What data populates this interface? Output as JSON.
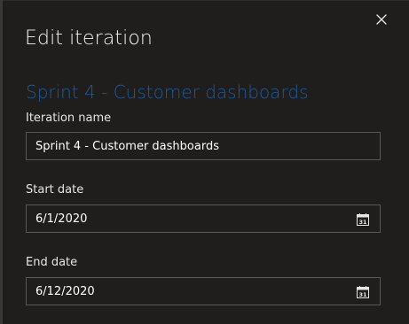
{
  "dialog": {
    "title": "Edit iteration",
    "close_icon": "close-icon"
  },
  "iteration": {
    "heading": "Sprint 4 - Customer dashboards"
  },
  "fields": {
    "name": {
      "label": "Iteration name",
      "value": "Sprint 4 - Customer dashboards"
    },
    "start_date": {
      "label": "Start date",
      "value": "6/1/2020",
      "icon": "calendar-icon",
      "icon_text": "31"
    },
    "end_date": {
      "label": "End date",
      "value": "6/12/2020",
      "icon": "calendar-icon",
      "icon_text": "31"
    }
  },
  "colors": {
    "background": "#1f1e1d",
    "accent": "#1e5a9c",
    "text": "#f3f2f1",
    "border": "#5a5856"
  }
}
